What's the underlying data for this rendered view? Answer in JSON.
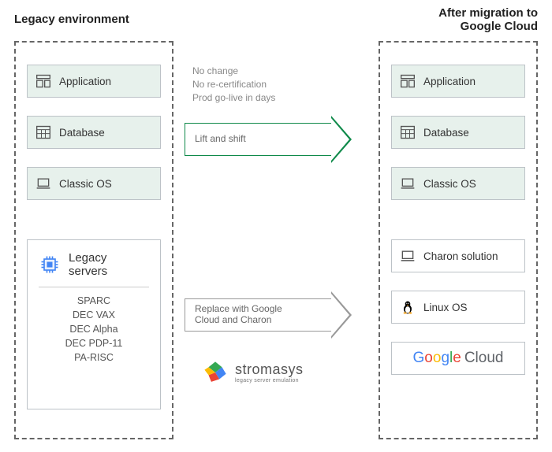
{
  "left": {
    "title": "Legacy environment",
    "layers": [
      "Application",
      "Database",
      "Classic OS"
    ],
    "servers": {
      "title": "Legacy\nservers",
      "list": [
        "SPARC",
        "DEC VAX",
        "DEC Alpha",
        "DEC PDP-11",
        "PA-RISC"
      ]
    }
  },
  "right": {
    "title": "After migration to\nGoogle Cloud",
    "layers": [
      "Application",
      "Database",
      "Classic OS",
      "Charon solution",
      "Linux OS",
      "Google Cloud"
    ]
  },
  "middle": {
    "notes": [
      "No change",
      "No re-certification",
      "Prod go-live in days"
    ],
    "arrow1": "Lift and shift",
    "arrow2": "Replace with Google\nCloud and Charon",
    "partner": {
      "name": "stromasys",
      "tag": "legacy server emulation"
    }
  }
}
